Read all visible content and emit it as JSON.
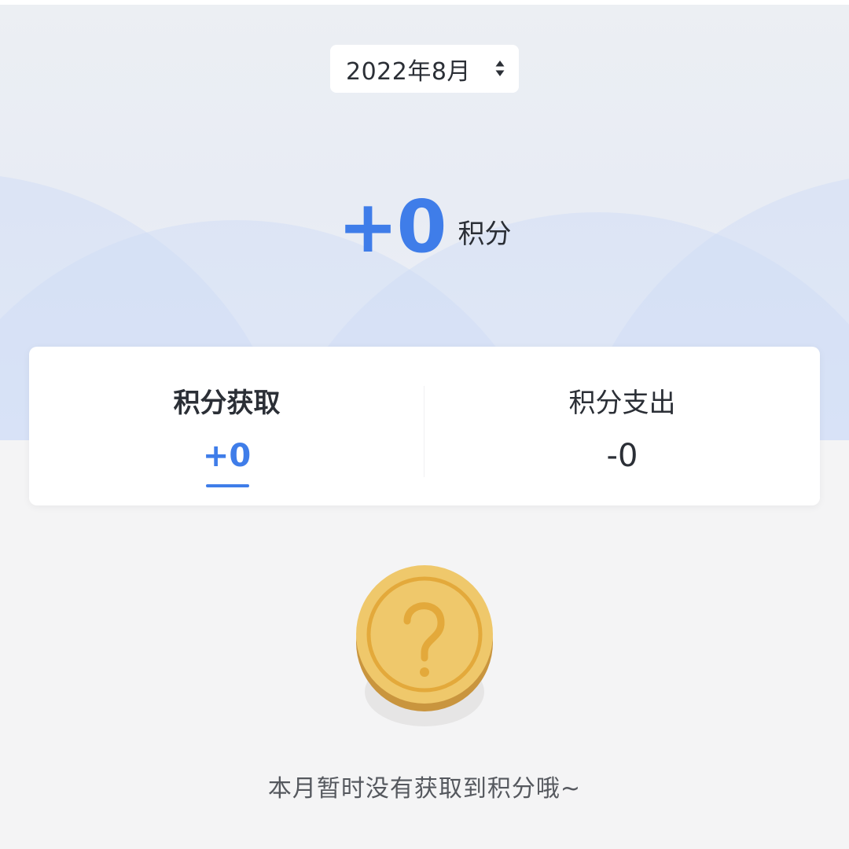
{
  "month_picker": {
    "value": "2022年8月",
    "icon": "sort-updown-icon"
  },
  "summary": {
    "total": "+0",
    "unit": "积分"
  },
  "tabs": [
    {
      "label": "积分获取",
      "value": "+0",
      "active": true
    },
    {
      "label": "积分支出",
      "value": "-0",
      "active": false
    }
  ],
  "empty_state": {
    "icon": "question-coin-icon",
    "message": "本月暂时没有获取到积分哦~"
  },
  "colors": {
    "accent": "#3f7de9",
    "coin": "#efc86b",
    "coin_ring": "#e3a93b"
  }
}
